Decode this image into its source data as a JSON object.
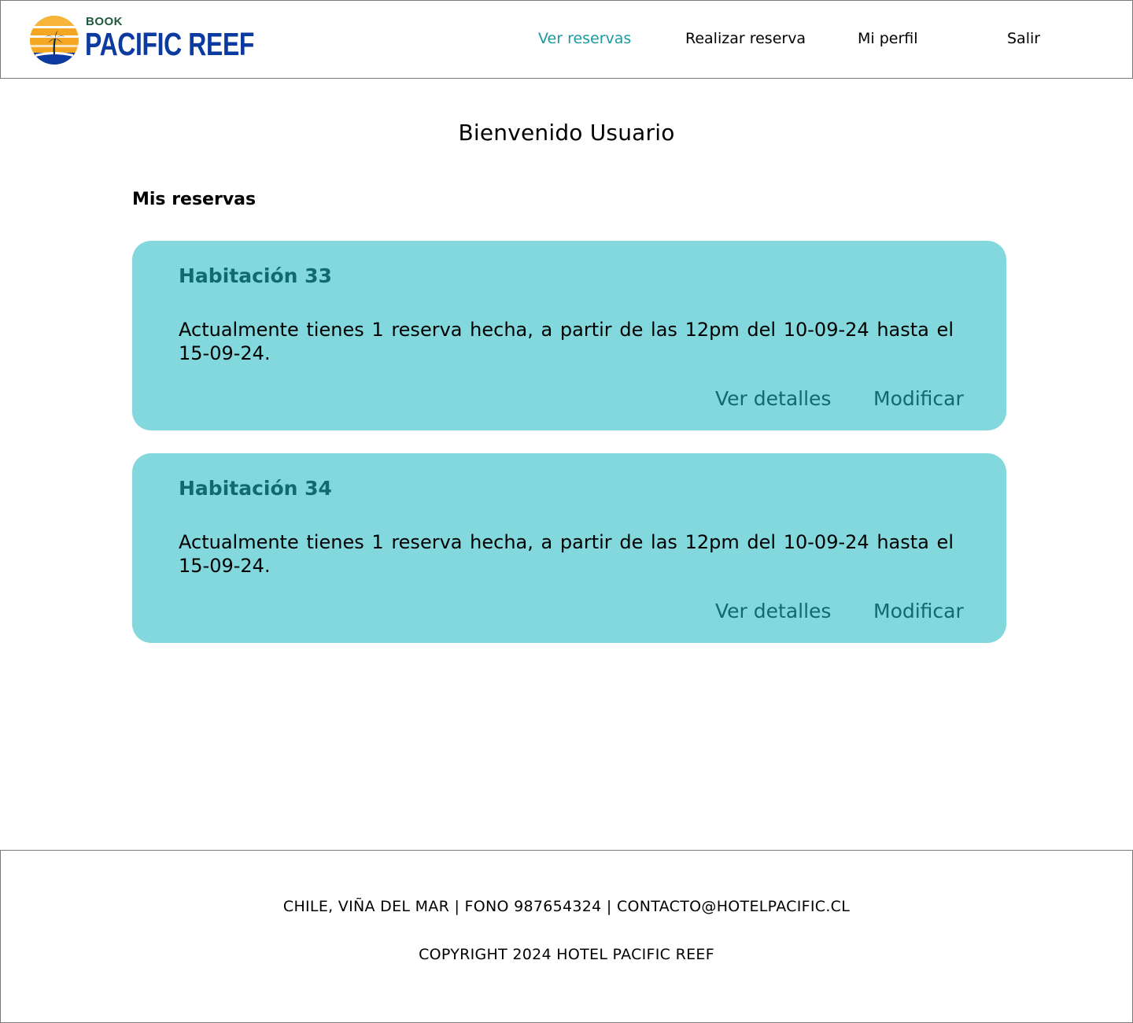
{
  "brand": {
    "top_label": "BOOK",
    "name": "PACIFIC REEF"
  },
  "nav": {
    "items": [
      {
        "label": "Ver reservas",
        "active": true
      },
      {
        "label": "Realizar reserva",
        "active": false
      },
      {
        "label": "Mi perfil",
        "active": false
      },
      {
        "label": "Salir",
        "active": false
      }
    ]
  },
  "main": {
    "title": "Bienvenido Usuario",
    "section_title": "Mis reservas",
    "reservations": [
      {
        "room": "Habitación 33",
        "description": "Actualmente tienes 1 reserva hecha, a partir de las 12pm del 10-09-24 hasta el 15-09-24.",
        "details_label": "Ver detalles",
        "modify_label": "Modificar"
      },
      {
        "room": "Habitación 34",
        "description": "Actualmente tienes 1 reserva hecha, a partir de las 12pm del 10-09-24 hasta el 15-09-24.",
        "details_label": "Ver detalles",
        "modify_label": "Modificar"
      }
    ]
  },
  "footer": {
    "contact": "CHILE, VIÑA DEL MAR | FONO 987654324 | CONTACTO@HOTELPACIFIC.CL",
    "copyright": "COPYRIGHT 2024 HOTEL PACIFIC REEF"
  },
  "colors": {
    "accent": "#1a9aa2",
    "card_bg": "#82d8dc",
    "card_text_accent": "#0f6a72",
    "brand_blue": "#0b3aa0",
    "sun_orange": "#f5a623"
  },
  "icons": {
    "logo": "sun-palm-logo-icon"
  }
}
